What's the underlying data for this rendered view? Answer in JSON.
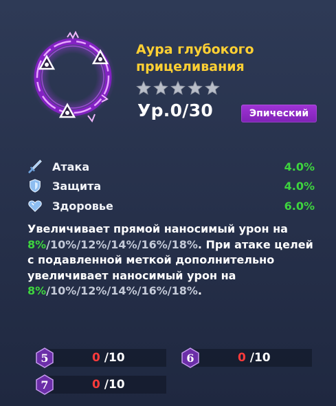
{
  "item": {
    "title_line1": "Аура глубокого",
    "title_line2": "прицеливания",
    "stars_total": 5,
    "stars_filled": 0,
    "level_text": "Ур.0/30",
    "rarity": "Эпический",
    "icon": "crosshair-aura-icon"
  },
  "stats": [
    {
      "label": "Атака",
      "value": "4.0%",
      "icon": "sword-icon"
    },
    {
      "label": "Защита",
      "value": "4.0%",
      "icon": "shield-icon"
    },
    {
      "label": "Здоровье",
      "value": "6.0%",
      "icon": "heart-icon"
    }
  ],
  "description": {
    "part1": "Увеличивает прямой наносимый урон на",
    "tiers1": [
      "8%",
      "10%",
      "12%",
      "14%",
      "16%",
      "18%"
    ],
    "part2": ". При атаке целей с подавленной меткой дополнительно увеличивает наносимый урон на",
    "tiers2": [
      "8%",
      "10%",
      "12%",
      "14%",
      "16%",
      "18%"
    ],
    "part3": "."
  },
  "slots": [
    {
      "badge": "5",
      "current": "0",
      "max": "/10"
    },
    {
      "badge": "6",
      "current": "0",
      "max": "/10"
    },
    {
      "badge": "7",
      "current": "0",
      "max": "/10"
    }
  ],
  "colors": {
    "title": "#ffd033",
    "stat_value": "#3ed53e",
    "highlight": "#3ed53e",
    "rarity_bg": "#8f2bc6",
    "count_current": "#ff3b3b"
  }
}
